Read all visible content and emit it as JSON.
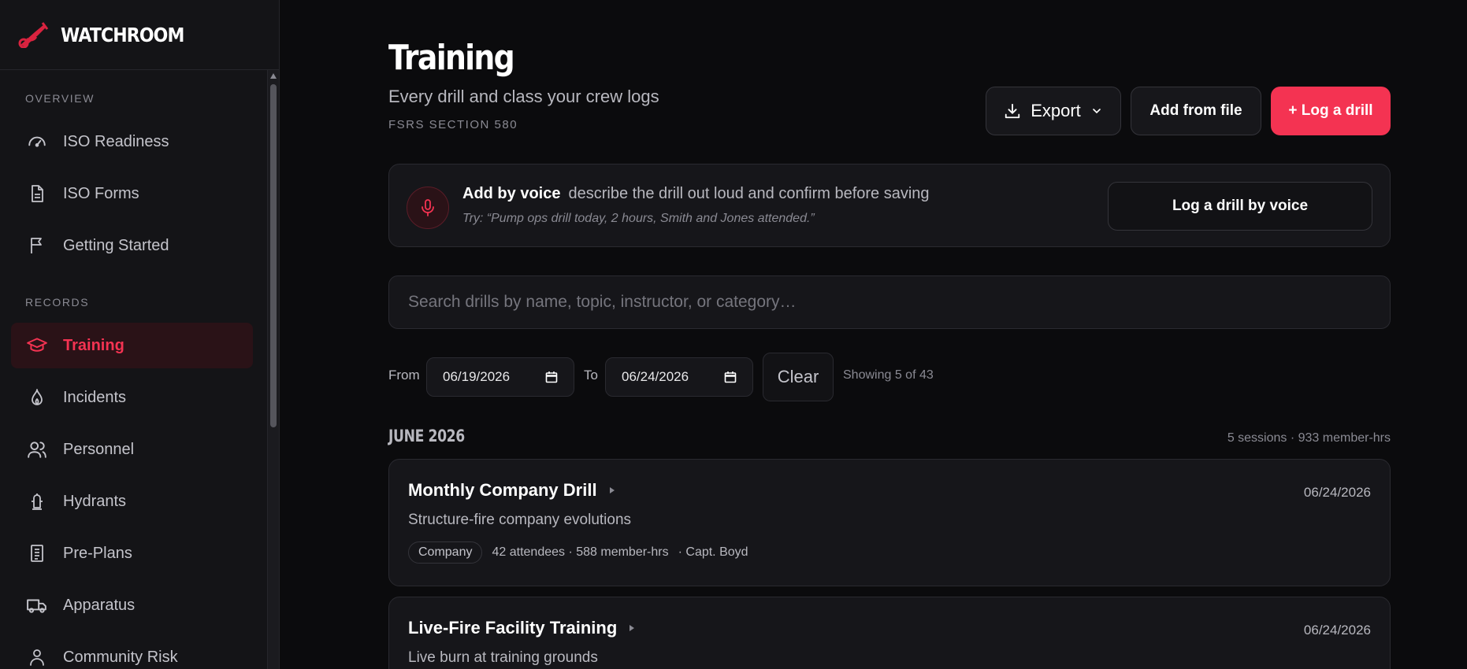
{
  "brand": {
    "name": "WATCHROOM"
  },
  "sidebar": {
    "sections": [
      {
        "label": "OVERVIEW",
        "items": [
          {
            "label": "ISO Readiness",
            "icon": "gauge-icon"
          },
          {
            "label": "ISO Forms",
            "icon": "document-icon"
          },
          {
            "label": "Getting Started",
            "icon": "flag-icon"
          }
        ]
      },
      {
        "label": "RECORDS",
        "items": [
          {
            "label": "Training",
            "icon": "graduation-cap-icon",
            "active": true
          },
          {
            "label": "Incidents",
            "icon": "flame-icon"
          },
          {
            "label": "Personnel",
            "icon": "users-icon"
          },
          {
            "label": "Hydrants",
            "icon": "hydrant-icon"
          },
          {
            "label": "Pre-Plans",
            "icon": "clipboard-icon"
          },
          {
            "label": "Apparatus",
            "icon": "truck-icon"
          },
          {
            "label": "Community Risk",
            "icon": "person-icon"
          }
        ]
      }
    ]
  },
  "header": {
    "title": "Training",
    "subtitle": "Every drill and class your crew logs",
    "section": "FSRS SECTION 580"
  },
  "actions": {
    "export_label": "Export",
    "add_file_label": "Add from file",
    "log_drill_label": "+ Log a drill"
  },
  "voice": {
    "title": "Add by voice",
    "description": "describe the drill out loud and confirm before saving",
    "example": "Try: “Pump ops drill today, 2 hours, Smith and Jones attended.”",
    "button_label": "Log a drill by voice"
  },
  "search": {
    "placeholder": "Search drills by name, topic, instructor, or category…"
  },
  "filters": {
    "from_label": "From",
    "from_value": "06/19/2026",
    "to_label": "To",
    "to_value": "06/24/2026",
    "clear_label": "Clear",
    "showing": "Showing 5 of 43"
  },
  "group": {
    "month": "JUNE 2026",
    "stats": "5 sessions · 933 member-hrs"
  },
  "drills": [
    {
      "title": "Monthly Company Drill",
      "date": "06/24/2026",
      "description": "Structure-fire company evolutions",
      "category": "Company",
      "stats": "42 attendees · 588 member-hrs",
      "instructor": "· Capt. Boyd"
    },
    {
      "title": "Live-Fire Facility Training",
      "date": "06/24/2026",
      "description": "Live burn at training grounds"
    }
  ],
  "colors": {
    "accent": "#f43352",
    "background": "#0b0b0d",
    "panel": "#16161a"
  }
}
